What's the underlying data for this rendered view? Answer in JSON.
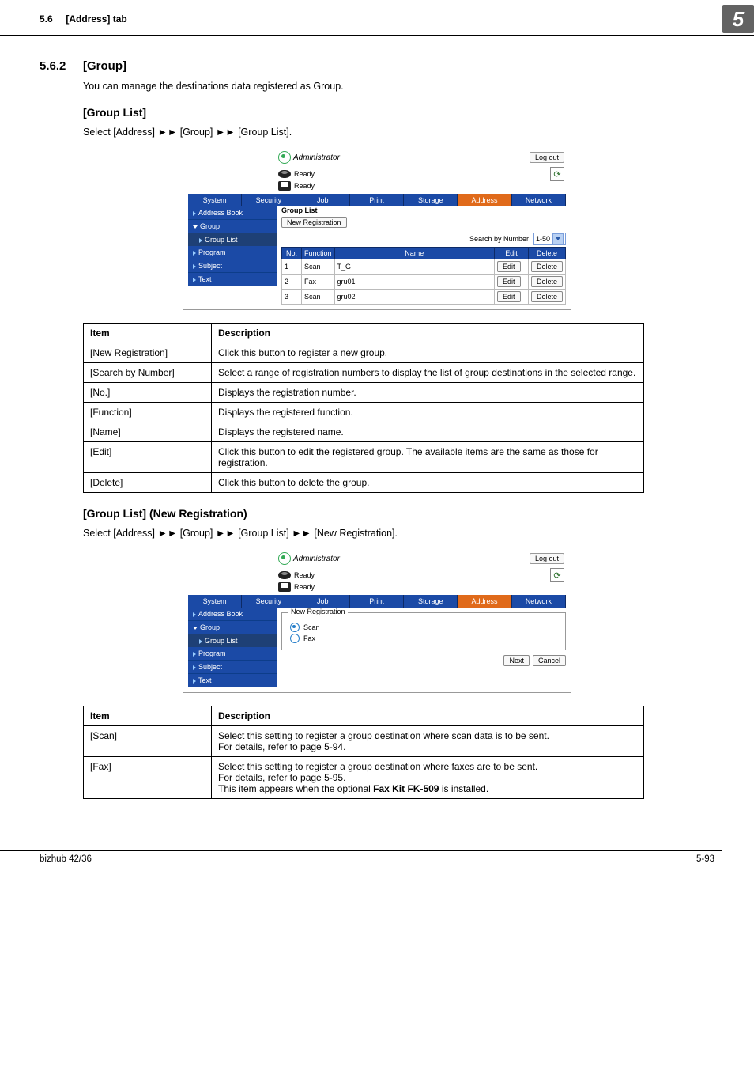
{
  "header": {
    "section_tab": "5.6",
    "tab_title": "[Address] tab",
    "chapter_num": "5"
  },
  "sec562": {
    "num": "5.6.2",
    "title": "[Group]",
    "intro": "You can manage the destinations data registered as Group.",
    "grouplist": {
      "title": "[Group List]",
      "nav": "Select [Address] ►► [Group] ►► [Group List]."
    },
    "grouplist_new": {
      "title": "[Group List] (New Registration)",
      "nav": "Select [Address] ►► [Group] ►► [Group List] ►► [New Registration]."
    }
  },
  "shot1": {
    "admin": "Administrator",
    "logout": "Log out",
    "ready": "Ready",
    "tabs": [
      "System",
      "Security",
      "Job",
      "Print",
      "Storage",
      "Address",
      "Network"
    ],
    "active_tab": "Address",
    "side": {
      "addressbook": "Address Book",
      "group": "Group",
      "grouplist": "Group List",
      "program": "Program",
      "subject": "Subject",
      "text": "Text"
    },
    "main": {
      "title": "Group List",
      "newreg": "New Registration",
      "search_label": "Search by Number",
      "range": "1-50",
      "cols": {
        "no": "No.",
        "func": "Function",
        "name": "Name",
        "edit": "Edit",
        "delete": "Delete"
      },
      "rows": [
        {
          "no": "1",
          "func": "Scan",
          "name": "T_G",
          "edit": "Edit",
          "delete": "Delete"
        },
        {
          "no": "2",
          "func": "Fax",
          "name": "gru01",
          "edit": "Edit",
          "delete": "Delete"
        },
        {
          "no": "3",
          "func": "Scan",
          "name": "gru02",
          "edit": "Edit",
          "delete": "Delete"
        }
      ]
    }
  },
  "shot2": {
    "legend_title": "New Registration",
    "scan": "Scan",
    "fax": "Fax",
    "next": "Next",
    "cancel": "Cancel"
  },
  "table1": {
    "head": {
      "item": "Item",
      "desc": "Description"
    },
    "rows": [
      {
        "item": "[New Registration]",
        "desc": "Click this button to register a new group."
      },
      {
        "item": "[Search by Number]",
        "desc": "Select a range of registration numbers to display the list of group destinations in the selected range."
      },
      {
        "item": "[No.]",
        "desc": "Displays the registration number."
      },
      {
        "item": "[Function]",
        "desc": "Displays the registered function."
      },
      {
        "item": "[Name]",
        "desc": "Displays the registered name."
      },
      {
        "item": "[Edit]",
        "desc": "Click this button to edit the registered group. The available items are the same as those for registration."
      },
      {
        "item": "[Delete]",
        "desc": "Click this button to delete the group."
      }
    ]
  },
  "table2": {
    "head": {
      "item": "Item",
      "desc": "Description"
    },
    "rows": [
      {
        "item": "[Scan]",
        "desc_l1": "Select this setting to register a group destination where scan data is to be sent.",
        "desc_l2": "For details, refer to page 5-94."
      },
      {
        "item": "[Fax]",
        "desc_l1": "Select this setting to register a group destination where faxes are to be sent.",
        "desc_l2": "For details, refer to page 5-95.",
        "desc_l3a": "This item appears when the optional ",
        "desc_l3b": "Fax Kit FK-509",
        "desc_l3c": " is installed."
      }
    ]
  },
  "footer": {
    "product": "bizhub 42/36",
    "pageno": "5-93"
  }
}
